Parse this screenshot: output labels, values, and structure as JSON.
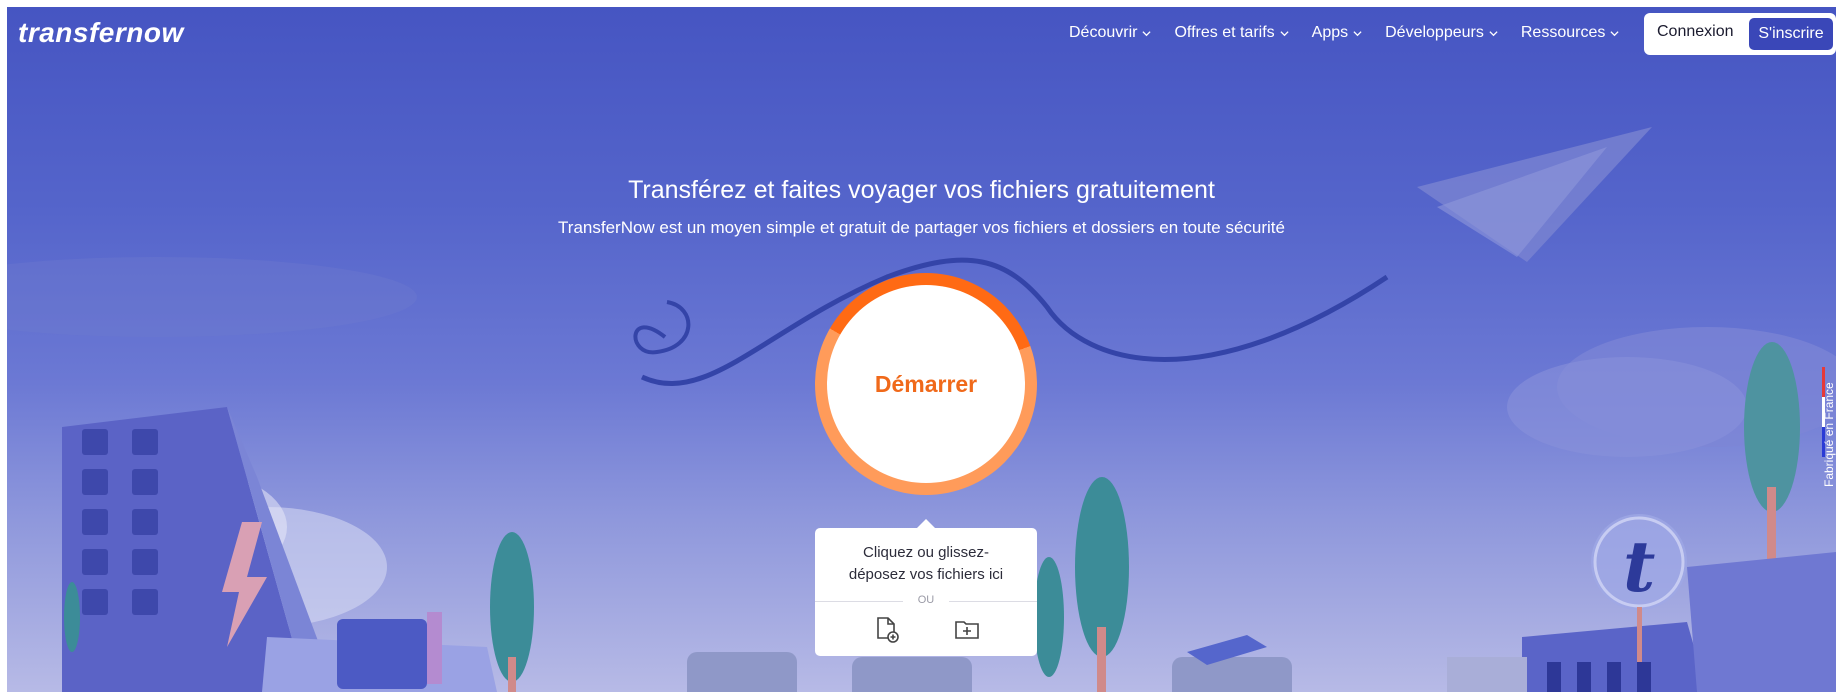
{
  "brand": {
    "logo_text": "transfernow"
  },
  "nav": {
    "items": [
      {
        "label": "Découvrir"
      },
      {
        "label": "Offres et tarifs"
      },
      {
        "label": "Apps"
      },
      {
        "label": "Développeurs"
      },
      {
        "label": "Ressources"
      }
    ],
    "login_label": "Connexion",
    "signup_label": "S'inscrire"
  },
  "hero": {
    "title": "Transférez et faites voyager vos fichiers gratuitement",
    "subtitle": "TransferNow est un moyen simple et gratuit de partager vos fichiers et dossiers en toute sécurité"
  },
  "uploader": {
    "start_label": "Démarrer",
    "drop_text": "Cliquez ou glissez-déposez vos fichiers ici",
    "or_label": "OU",
    "add_file_icon": "file-plus-icon",
    "add_folder_icon": "folder-plus-icon"
  },
  "badge": {
    "label": "Fabriqué en France"
  },
  "colors": {
    "accent": "#f0691a",
    "brand": "#3a47b8",
    "sky": "#4655c2"
  }
}
